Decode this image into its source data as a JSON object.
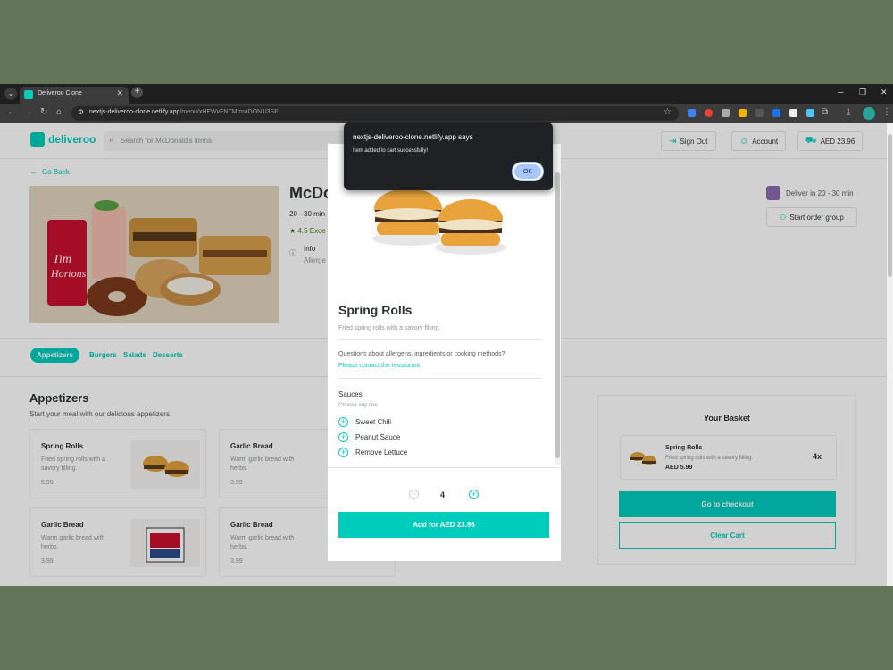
{
  "browser": {
    "tab_title": "Deliveroo Clone",
    "url_host": "nextjs-deliveroo-clone.netlify.app",
    "url_path": "/menu/xHEWvFNTMrmaDON1l3SF"
  },
  "header": {
    "logo": "deliveroo",
    "search_placeholder": "Search for McDonald's items",
    "sign_out": "Sign Out",
    "account": "Account",
    "cart_total": "AED 23.96"
  },
  "restaurant": {
    "go_back": "Go Back",
    "name": "McDo",
    "time": "20 - 30 min",
    "rating": "4.5 Exce",
    "info_title": "Info",
    "info_sub": "Allerge",
    "deliver": "Deliver in 20 - 30 min",
    "start_group": "Start order group"
  },
  "categories": [
    "Appetizers",
    "Burgers",
    "Salads",
    "Desserts"
  ],
  "section": {
    "title": "Appetizers",
    "subtitle": "Start your meal with our delicious appetizers."
  },
  "items": [
    {
      "name": "Spring Rolls",
      "desc": "Fried spring rolls with a savory filling.",
      "price": "5.99"
    },
    {
      "name": "Garlic Bread",
      "desc": "Warm garlic bread with herbs.",
      "price": "3.99"
    },
    {
      "name": "Garlic Bread",
      "desc": "Warm garlic bread with herbs.",
      "price": "3.99"
    },
    {
      "name": "Garlic Bread",
      "desc": "Warm garlic bread with herbs.",
      "price": "3.99"
    }
  ],
  "basket": {
    "title": "Your Basket",
    "item_name": "Spring Rolls",
    "item_desc": "Fried spring rolls with a savory filling.",
    "item_price": "AED 5.99",
    "item_qty": "4x",
    "checkout": "Go to checkout",
    "clear": "Clear Cart"
  },
  "modal": {
    "title": "Spring Rolls",
    "desc": "Fried spring rolls with a savory filling.",
    "question": "Questions about allergens, ingredients or cooking methods?",
    "contact": "Please contact the restaurant.",
    "sauces_title": "Sauces",
    "sauces_sub": "Choose any one",
    "options": [
      "Sweet Chili",
      "Peanut Sauce",
      "Remove Lettuce"
    ],
    "quantity": "4",
    "add_button": "Add for AED 23.96"
  },
  "alert": {
    "title": "nextjs-deliveroo-clone.netlify.app says",
    "message": "Item added to cart successfully!",
    "ok": "OK"
  },
  "colors": {
    "accent": "#00ccbc",
    "desktop_bg": "#627559"
  }
}
